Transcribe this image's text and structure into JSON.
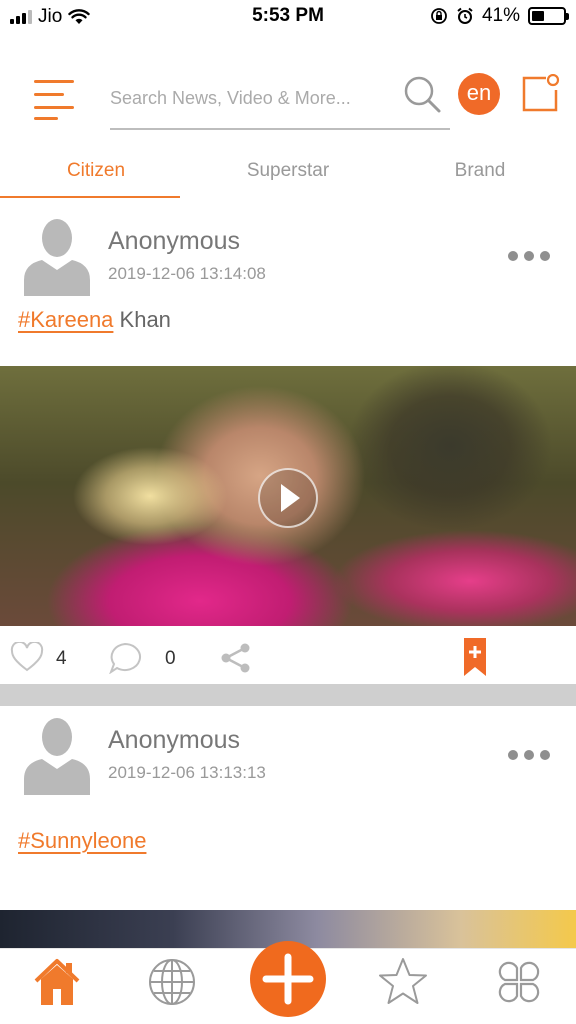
{
  "status_bar": {
    "carrier": "Jio",
    "time": "5:53 PM",
    "battery": "41%",
    "battery_level": 0.41,
    "icons": [
      "signal-icon",
      "wifi-icon",
      "rotation-lock-icon",
      "alarm-icon",
      "battery-icon"
    ]
  },
  "header": {
    "search_placeholder": "Search News, Video & More...",
    "language": "en",
    "icons": [
      "menu-icon",
      "search-icon",
      "compose-icon"
    ]
  },
  "tabs": [
    {
      "label": "Citizen",
      "active": true
    },
    {
      "label": "Superstar",
      "active": false
    },
    {
      "label": "Brand",
      "active": false
    }
  ],
  "posts": [
    {
      "author": "Anonymous",
      "timestamp": "2019-12-06 13:14:08",
      "hashtag": "#Kareena",
      "text": " Khan",
      "likes": "4",
      "comments": "0"
    },
    {
      "author": "Anonymous",
      "timestamp": "2019-12-06 13:13:13",
      "hashtag": "#Sunnyleone",
      "text": ""
    }
  ],
  "bottom_nav": [
    "home-icon",
    "globe-icon",
    "add-icon",
    "star-icon",
    "apps-icon"
  ],
  "colors": {
    "accent": "#f07a2c",
    "muted_text": "#999999",
    "divider": "#cfcfcf"
  }
}
